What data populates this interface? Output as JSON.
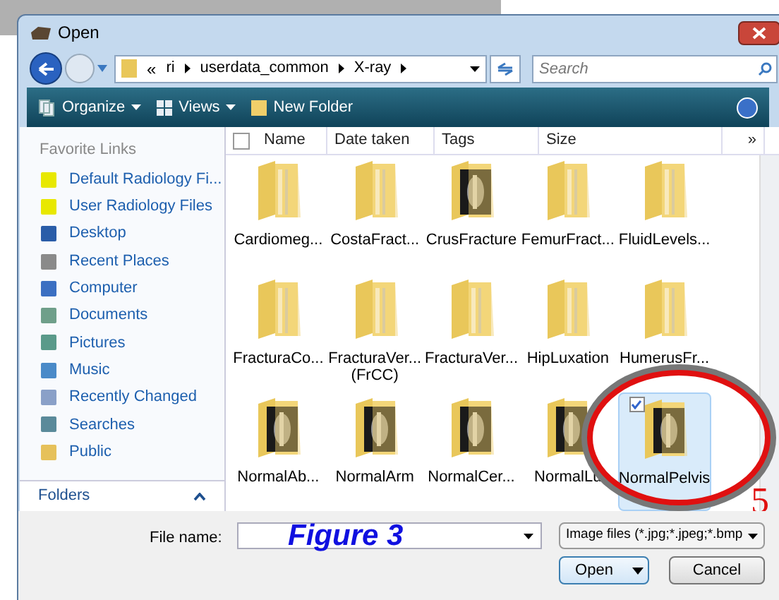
{
  "window": {
    "title": "Open"
  },
  "address": {
    "overflow": "«",
    "crumbs": [
      "ri",
      "userdata_common",
      "X-ray"
    ]
  },
  "search": {
    "placeholder": "Search"
  },
  "toolbar": [
    "Organize",
    "Views",
    "New Folder"
  ],
  "sidebar": {
    "title": "Favorite Links",
    "items": [
      {
        "label": "Default Radiology Fi..."
      },
      {
        "label": "User Radiology Files"
      },
      {
        "label": "Desktop"
      },
      {
        "label": "Recent Places"
      },
      {
        "label": "Computer"
      },
      {
        "label": "Documents"
      },
      {
        "label": "Pictures"
      },
      {
        "label": "Music"
      },
      {
        "label": "Recently Changed"
      },
      {
        "label": "Searches"
      },
      {
        "label": "Public"
      }
    ],
    "folders": "Folders",
    "folders_expanded": false
  },
  "select_all_checked": false,
  "columns": [
    "Name",
    "Date taken",
    "Tags",
    "Size",
    "»"
  ],
  "files": [
    {
      "name": "Cardiomeg...",
      "kind": "folder",
      "selected": false
    },
    {
      "name": "CostaFract...",
      "kind": "folder",
      "selected": false
    },
    {
      "name": "CrusFracture",
      "kind": "xray",
      "selected": false
    },
    {
      "name": "FemurFract...",
      "kind": "folder",
      "selected": false
    },
    {
      "name": "FluidLevels...",
      "kind": "folder",
      "selected": false
    },
    {
      "name": "FracturaCo...",
      "kind": "folder",
      "selected": false
    },
    {
      "name": "FracturaVer... (FrCC)",
      "kind": "folder",
      "selected": false
    },
    {
      "name": "FracturaVer...",
      "kind": "folder",
      "selected": false
    },
    {
      "name": "HipLuxation",
      "kind": "folder",
      "selected": false
    },
    {
      "name": "HumerusFr...",
      "kind": "folder",
      "selected": false
    },
    {
      "name": "NormalAb...",
      "kind": "xray",
      "selected": false
    },
    {
      "name": "NormalArm",
      "kind": "xray",
      "selected": false
    },
    {
      "name": "NormalCer...",
      "kind": "xray",
      "selected": false
    },
    {
      "name": "NormalLu",
      "kind": "xray",
      "selected": false
    },
    {
      "name": "NormalPelvis",
      "kind": "xray",
      "selected": true
    }
  ],
  "file_name": {
    "label": "File name:"
  },
  "file_type": "Image files (*.jpg;*.jpeg;*.bmp",
  "buttons": [
    "Open",
    "Cancel"
  ],
  "annotations": {
    "caption": "Figure 3",
    "marker": "5"
  }
}
